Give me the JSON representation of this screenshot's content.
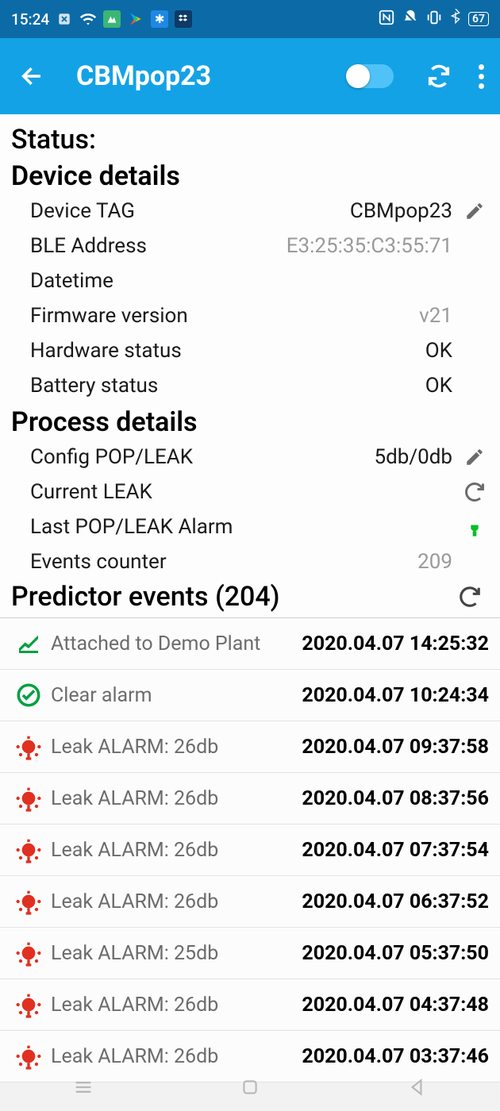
{
  "status_bar": {
    "time": "15:24",
    "battery": "67"
  },
  "app_bar": {
    "title": "CBMpop23"
  },
  "status_label": "Status:",
  "device_details": {
    "title": "Device details",
    "rows": {
      "tag": {
        "label": "Device TAG",
        "value": "CBMpop23"
      },
      "ble": {
        "label": "BLE Address",
        "value": "E3:25:35:C3:55:71"
      },
      "datetime": {
        "label": "Datetime",
        "value": ""
      },
      "firmware": {
        "label": "Firmware version",
        "value": "v21"
      },
      "hw_status": {
        "label": "Hardware status",
        "value": "OK"
      },
      "batt_status": {
        "label": "Battery status",
        "value": "OK"
      }
    }
  },
  "process_details": {
    "title": "Process details",
    "rows": {
      "config": {
        "label": "Config POP/LEAK",
        "value": "5db/0db"
      },
      "current_leak": {
        "label": "Current LEAK",
        "value": ""
      },
      "last_alarm": {
        "label": "Last POP/LEAK Alarm",
        "value": ""
      },
      "events_counter": {
        "label": "Events counter",
        "value": "209"
      }
    }
  },
  "predictor": {
    "title_prefix": "Predictor events",
    "count": "(204)",
    "events": [
      {
        "icon": "attach",
        "label": "Attached to Demo Plant",
        "time": "2020.04.07 14:25:32"
      },
      {
        "icon": "clear",
        "label": "Clear alarm",
        "time": "2020.04.07 10:24:34"
      },
      {
        "icon": "leak",
        "label": "Leak ALARM: 26db",
        "time": "2020.04.07 09:37:58"
      },
      {
        "icon": "leak",
        "label": "Leak ALARM: 26db",
        "time": "2020.04.07 08:37:56"
      },
      {
        "icon": "leak",
        "label": "Leak ALARM: 26db",
        "time": "2020.04.07 07:37:54"
      },
      {
        "icon": "leak",
        "label": "Leak ALARM: 26db",
        "time": "2020.04.07 06:37:52"
      },
      {
        "icon": "leak",
        "label": "Leak ALARM: 25db",
        "time": "2020.04.07 05:37:50"
      },
      {
        "icon": "leak",
        "label": "Leak ALARM: 26db",
        "time": "2020.04.07 04:37:48"
      },
      {
        "icon": "leak",
        "label": "Leak ALARM: 26db",
        "time": "2020.04.07 03:37:46"
      }
    ]
  },
  "colors": {
    "brand_blue": "#14a2e6",
    "status_blue": "#0c6ba7",
    "green": "#00b050",
    "red": "#e53935",
    "gray_text": "#9a9a9a"
  }
}
